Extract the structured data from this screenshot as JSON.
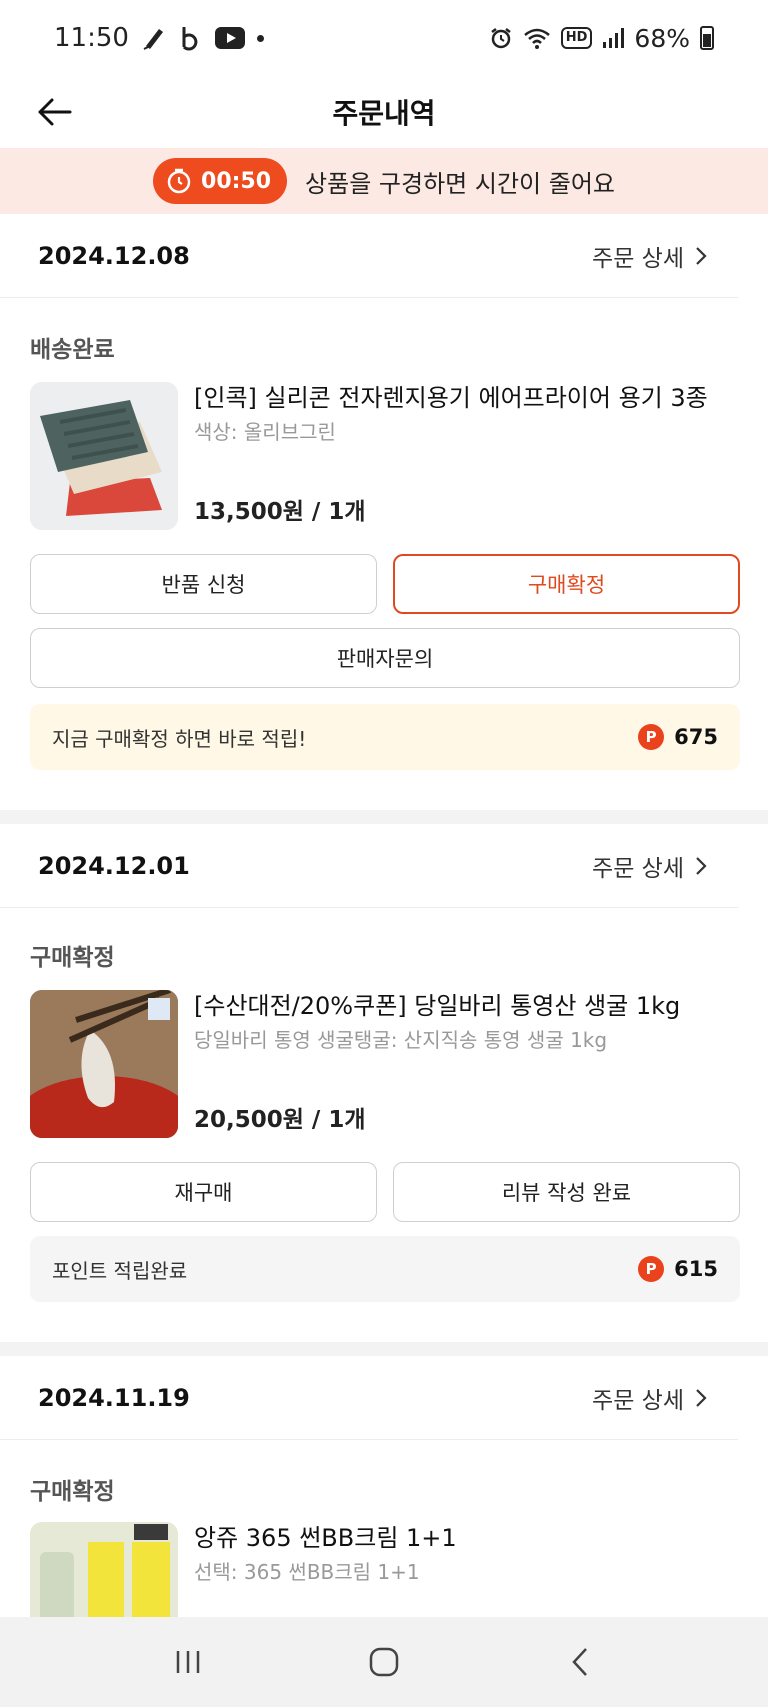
{
  "status_bar": {
    "time": "11:50",
    "battery": "68%"
  },
  "header": {
    "title": "주문내역"
  },
  "timer": {
    "time": "00:50",
    "message": "상품을 구경하면 시간이 줄어요"
  },
  "orders": [
    {
      "date": "2024.12.08",
      "detail_label": "주문 상세",
      "status": "배송완료",
      "product_name": "[인콕] 실리콘 전자렌지용기 에어프라이어 용기 3종",
      "option": "색상: 올리브그린",
      "price": "13,500원 / 1개",
      "buttons": [
        "반품 신청",
        "구매확정"
      ],
      "wide_button": "판매자문의",
      "point_message": "지금 구매확정 하면 바로 적립!",
      "points": "675"
    },
    {
      "date": "2024.12.01",
      "detail_label": "주문 상세",
      "status": "구매확정",
      "product_name": "[수산대전/20%쿠폰] 당일바리 통영산 생굴 1kg",
      "option": "당일바리 통영 생굴탱굴: 산지직송 통영 생굴 1kg",
      "price": "20,500원 / 1개",
      "buttons": [
        "재구매",
        "리뷰 작성 완료"
      ],
      "point_message": "포인트 적립완료",
      "points": "615"
    },
    {
      "date": "2024.11.19",
      "detail_label": "주문 상세",
      "status": "구매확정",
      "product_name": "앙쥬 365 썬BB크림 1+1",
      "option": "선택: 365 썬BB크림 1+1"
    }
  ],
  "point_icon_letter": "P",
  "colors": {
    "accent": "#ee4b1f",
    "banner_bg": "#fde9e3",
    "point_bg": "#fff8e6"
  }
}
